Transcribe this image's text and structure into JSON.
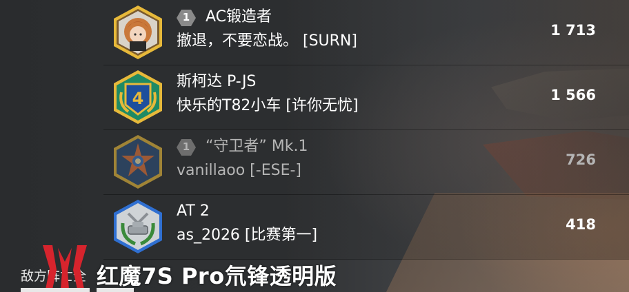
{
  "colors": {
    "accent_gold": "#e7b93a",
    "blue_frame": "#2f6fd1",
    "red_logo": "#d6242d",
    "dim_text": "#b5b5b5"
  },
  "rows": [
    {
      "emblem_icon": "anime-avatar-icon",
      "rank_badge": "1",
      "title": "AC锻造者",
      "name": "撤退，不要恋战。 [SURN]",
      "score": "1 713",
      "dim": false
    },
    {
      "emblem_icon": "rank-4-emblem-icon",
      "rank_badge": "",
      "title": "斯柯达 P-JS",
      "name": "快乐的T82小车 [许你无忧]",
      "score": "1 566",
      "dim": false
    },
    {
      "emblem_icon": "star-medal-icon",
      "rank_badge": "1",
      "title": "“守卫者” Mk.1",
      "name": "vanillaoo [-ESE-]",
      "score": "726",
      "dim": true
    },
    {
      "emblem_icon": "tank-wreath-icon",
      "rank_badge": "",
      "title": "AT 2",
      "name": "as_2026 [比赛第一]",
      "score": "418",
      "dim": false
    }
  ],
  "footer": {
    "label": "敌方阵亡全",
    "watermark": "红魔7S Pro氘锋透明版",
    "logo_icon": "red-magic-logo-icon"
  }
}
